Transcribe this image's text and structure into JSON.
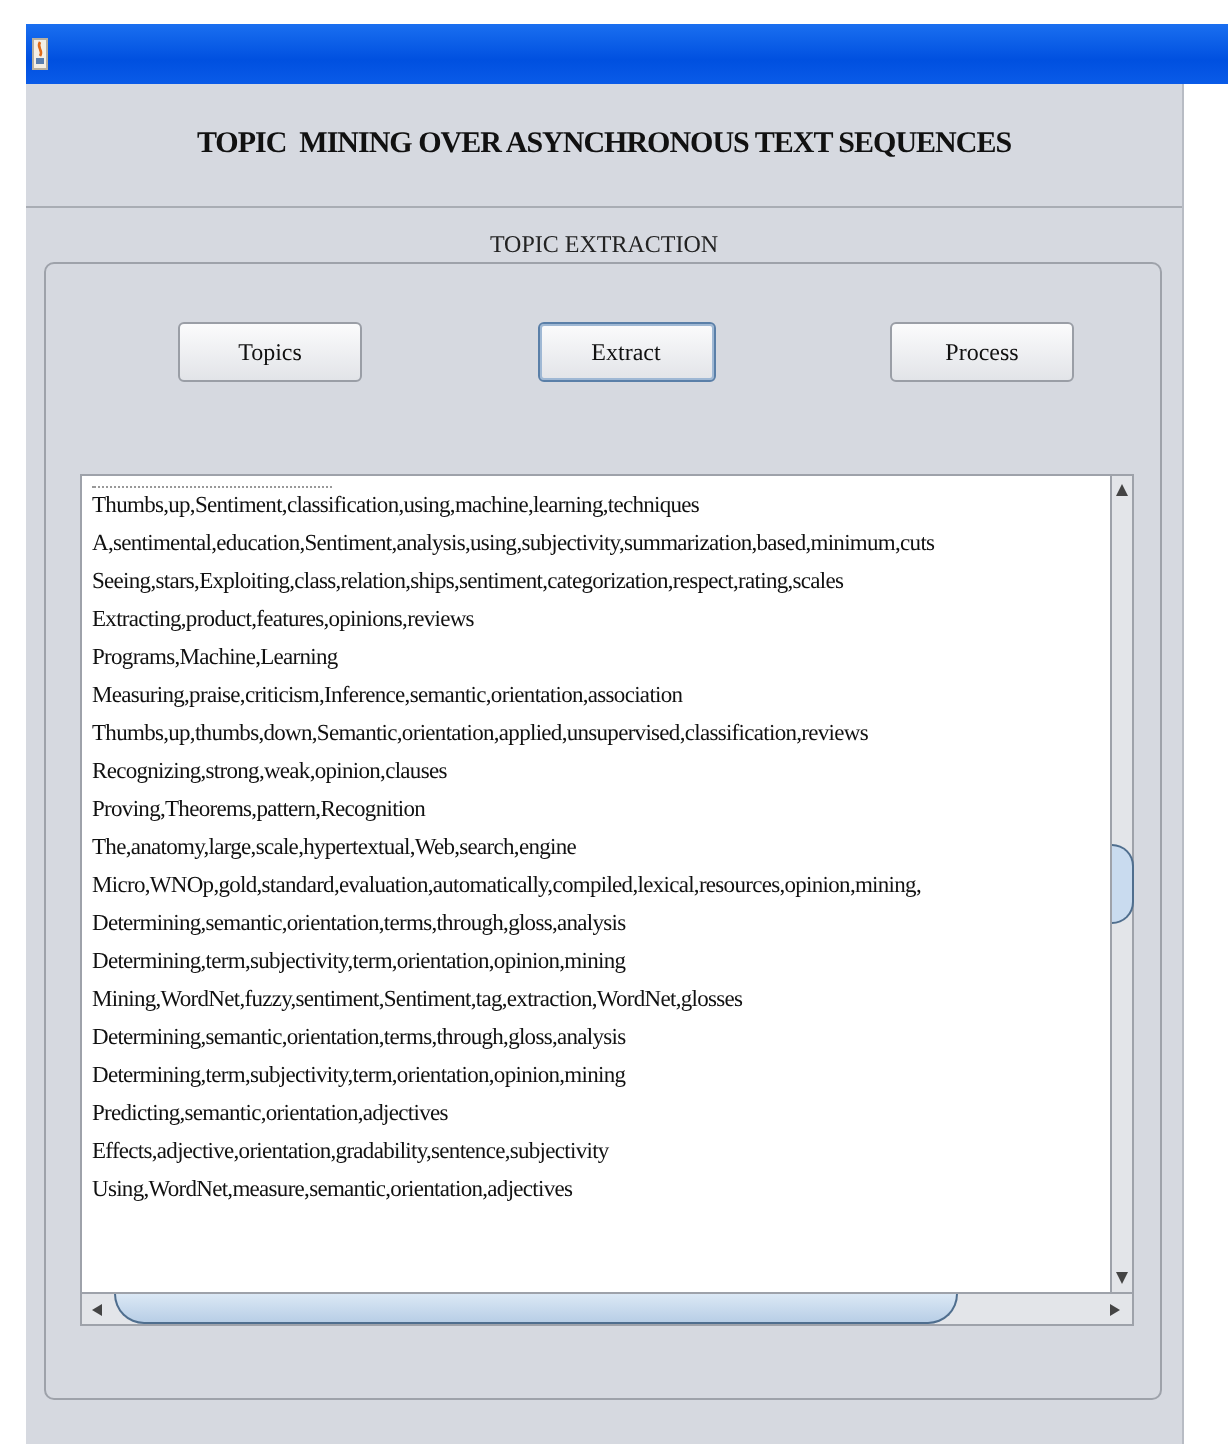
{
  "window": {
    "title": "TOPIC  MINING OVER ASYNCHRONOUS TEXT SEQUENCES"
  },
  "group": {
    "label": "TOPIC EXTRACTION"
  },
  "buttons": [
    {
      "label": "Topics",
      "focused": false
    },
    {
      "label": "Extract",
      "focused": true
    },
    {
      "label": "Process",
      "focused": false
    }
  ],
  "results": [
    "Thumbs,up,Sentiment,classification,using,machine,learning,techniques",
    "A,sentimental,education,Sentiment,analysis,using,subjectivity,summarization,based,minimum,cuts",
    "Seeing,stars,Exploiting,class,relation,ships,sentiment,categorization,respect,rating,scales",
    "Extracting,product,features,opinions,reviews",
    "Programs,Machine,Learning",
    "Measuring,praise,criticism,Inference,semantic,orientation,association",
    "Thumbs,up,thumbs,down,Semantic,orientation,applied,unsupervised,classification,reviews",
    "Recognizing,strong,weak,opinion,clauses",
    "Proving,Theorems,pattern,Recognition",
    "The,anatomy,large,scale,hypertextual,Web,search,engine",
    "Micro,WNOp,gold,standard,evaluation,automatically,compiled,lexical,resources,opinion,mining,",
    "Determining,semantic,orientation,terms,through,gloss,analysis",
    "Determining,term,subjectivity,term,orientation,opinion,mining",
    "Mining,WordNet,fuzzy,sentiment,Sentiment,tag,extraction,WordNet,glosses",
    "Determining,semantic,orientation,terms,through,gloss,analysis",
    "Determining,term,subjectivity,term,orientation,opinion,mining",
    "Predicting,semantic,orientation,adjectives",
    "Effects,adjective,orientation,gradability,sentence,subjectivity",
    "Using,WordNet,measure,semantic,orientation,adjectives"
  ]
}
